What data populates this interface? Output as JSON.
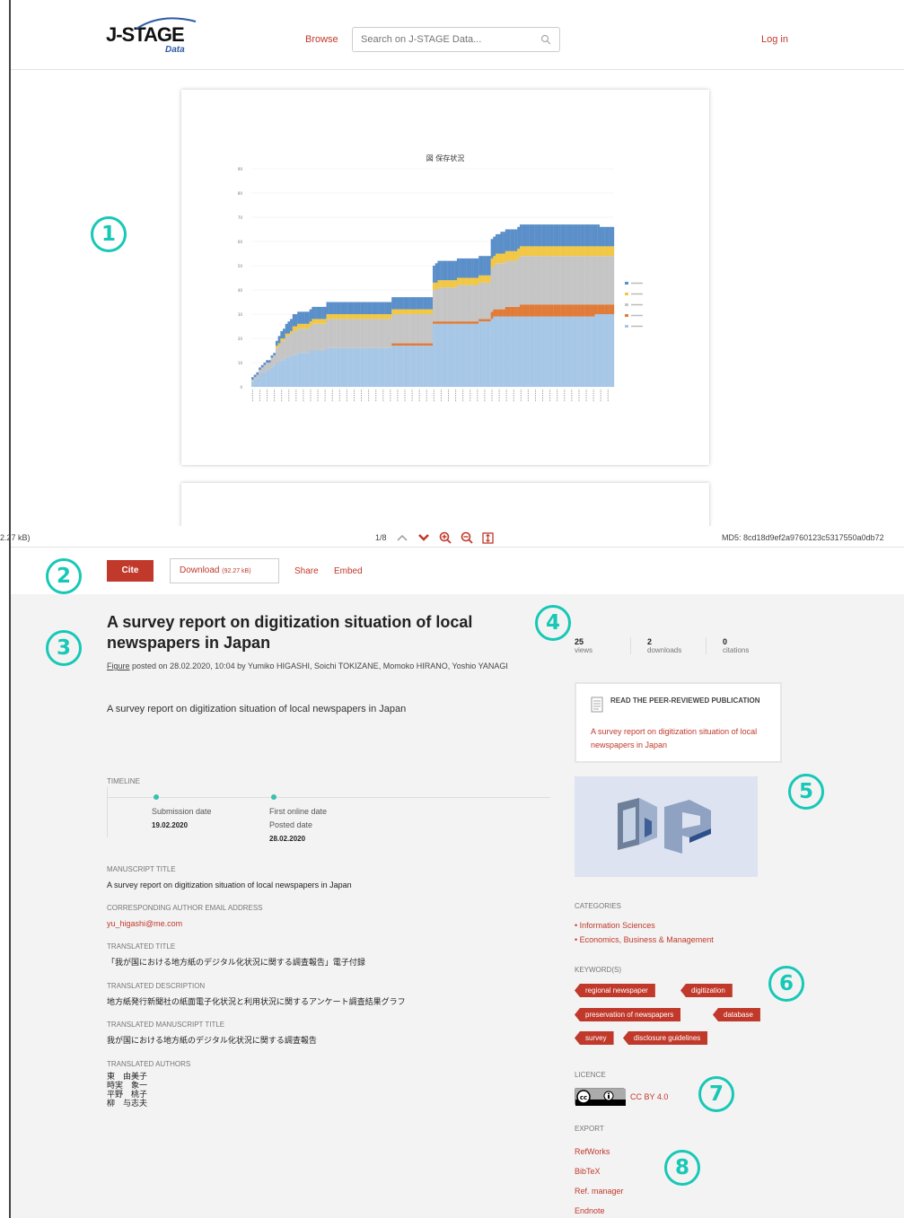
{
  "header": {
    "logo_text": "J-STAGE",
    "logo_sub": "Data",
    "browse_label": "Browse",
    "search_placeholder": "Search on J-STAGE Data...",
    "login_label": "Log in"
  },
  "viewer": {
    "chart_title": "図 保存状況",
    "file_size_left": "2.27 kB)",
    "page_indicator": "1/8",
    "md5": "MD5: 8cd18d9ef2a9760123c5317550a0db72"
  },
  "chart_data": {
    "type": "area",
    "title": "図 保存状況",
    "ylim": [
      0,
      90
    ],
    "yticks": [
      "0",
      "10",
      "20",
      "30",
      "40",
      "50",
      "60",
      "70",
      "80",
      "90"
    ],
    "x_count": 150,
    "stacked": true,
    "series": [
      {
        "color": "#a7c7e6",
        "values": [
          2,
          3,
          4,
          5,
          6,
          6,
          7,
          7,
          8,
          9,
          10,
          10,
          11,
          11,
          12,
          12,
          13,
          13,
          13,
          14,
          14,
          14,
          14,
          14,
          15,
          15,
          15,
          15,
          15,
          15,
          15,
          16,
          16,
          16,
          16,
          16,
          16,
          16,
          16,
          16,
          16,
          16,
          16,
          16,
          16,
          16,
          16,
          16,
          16,
          16,
          16,
          16,
          16,
          16,
          16,
          16,
          16,
          16,
          17,
          17,
          17,
          17,
          17,
          17,
          17,
          17,
          17,
          17,
          17,
          17,
          17,
          17,
          17,
          17,
          17,
          26,
          26,
          26,
          26,
          26,
          26,
          26,
          26,
          26,
          26,
          26,
          26,
          26,
          26,
          26,
          26,
          26,
          26,
          26,
          27,
          27,
          27,
          27,
          27,
          28,
          29,
          29,
          29,
          29,
          29,
          29,
          29,
          29,
          29,
          29,
          29,
          29,
          29,
          29,
          29,
          29,
          29,
          29,
          29,
          29,
          29,
          29,
          29,
          29,
          29,
          29,
          29,
          29,
          29,
          29,
          29,
          29,
          29,
          29,
          29,
          29,
          29,
          29,
          29,
          29,
          29,
          29,
          30,
          30,
          30,
          30,
          30,
          30,
          30,
          30
        ]
      },
      {
        "color": "#e07b39",
        "values": [
          0,
          0,
          0,
          0,
          0,
          0,
          0,
          0,
          0,
          0,
          0,
          0,
          0,
          0,
          0,
          0,
          0,
          0,
          0,
          0,
          0,
          0,
          0,
          0,
          0,
          0,
          0,
          0,
          0,
          0,
          0,
          0,
          0,
          0,
          0,
          0,
          0,
          0,
          0,
          0,
          0,
          0,
          0,
          0,
          0,
          0,
          0,
          0,
          0,
          0,
          0,
          0,
          0,
          0,
          0,
          0,
          0,
          0,
          1,
          1,
          1,
          1,
          1,
          1,
          1,
          1,
          1,
          1,
          1,
          1,
          1,
          1,
          1,
          1,
          1,
          1,
          1,
          1,
          1,
          1,
          1,
          1,
          1,
          1,
          1,
          1,
          1,
          1,
          1,
          1,
          1,
          1,
          1,
          1,
          1,
          1,
          1,
          1,
          1,
          3,
          3,
          3,
          3,
          3,
          3,
          4,
          4,
          4,
          4,
          4,
          4,
          5,
          5,
          5,
          5,
          5,
          5,
          5,
          5,
          5,
          5,
          5,
          5,
          5,
          5,
          5,
          5,
          5,
          5,
          5,
          5,
          5,
          5,
          5,
          5,
          5,
          5,
          5,
          5,
          5,
          5,
          5,
          4,
          4,
          4,
          4,
          4,
          4,
          4,
          4
        ]
      },
      {
        "color": "#c5c5c5",
        "values": [
          1,
          1,
          1,
          2,
          2,
          3,
          3,
          3,
          4,
          4,
          6,
          7,
          8,
          8,
          9,
          9,
          9,
          10,
          10,
          10,
          10,
          10,
          10,
          10,
          10,
          11,
          11,
          11,
          11,
          11,
          11,
          12,
          12,
          12,
          12,
          12,
          12,
          12,
          12,
          12,
          12,
          12,
          12,
          12,
          12,
          12,
          12,
          12,
          12,
          12,
          12,
          12,
          12,
          12,
          12,
          12,
          12,
          12,
          12,
          12,
          12,
          12,
          12,
          12,
          12,
          12,
          12,
          12,
          12,
          12,
          12,
          12,
          12,
          12,
          12,
          13,
          13,
          14,
          14,
          14,
          14,
          14,
          14,
          14,
          14,
          15,
          15,
          15,
          15,
          15,
          15,
          15,
          15,
          15,
          15,
          15,
          15,
          15,
          15,
          18,
          18,
          19,
          19,
          19,
          19,
          19,
          19,
          19,
          19,
          19,
          20,
          20,
          20,
          20,
          20,
          20,
          20,
          20,
          20,
          20,
          20,
          20,
          20,
          20,
          20,
          20,
          20,
          20,
          20,
          20,
          20,
          20,
          20,
          20,
          20,
          20,
          20,
          20,
          20,
          20,
          20,
          20,
          20,
          20,
          20,
          20,
          20,
          20,
          20,
          20
        ]
      },
      {
        "color": "#f2c744",
        "values": [
          0,
          0,
          0,
          0,
          0,
          0,
          0,
          0,
          0,
          0,
          1,
          1,
          1,
          1,
          1,
          1,
          1,
          2,
          2,
          2,
          2,
          2,
          2,
          2,
          2,
          2,
          2,
          2,
          2,
          2,
          2,
          2,
          2,
          2,
          2,
          2,
          2,
          2,
          2,
          2,
          2,
          2,
          2,
          2,
          2,
          2,
          2,
          2,
          2,
          2,
          2,
          2,
          2,
          2,
          2,
          2,
          2,
          2,
          2,
          2,
          2,
          2,
          2,
          2,
          2,
          2,
          2,
          2,
          2,
          2,
          2,
          2,
          2,
          2,
          2,
          3,
          3,
          3,
          3,
          3,
          3,
          3,
          3,
          3,
          3,
          3,
          3,
          3,
          3,
          3,
          3,
          3,
          3,
          3,
          3,
          3,
          3,
          3,
          3,
          4,
          4,
          4,
          4,
          4,
          4,
          4,
          4,
          4,
          4,
          4,
          4,
          4,
          4,
          4,
          4,
          4,
          4,
          4,
          4,
          4,
          4,
          4,
          4,
          4,
          4,
          4,
          4,
          4,
          4,
          4,
          4,
          4,
          4,
          4,
          4,
          4,
          4,
          4,
          4,
          4,
          4,
          4,
          4,
          4,
          4,
          4,
          4,
          4,
          4,
          4
        ]
      },
      {
        "color": "#5b8fc9",
        "values": [
          1,
          1,
          1,
          1,
          1,
          1,
          1,
          1,
          1,
          1,
          2,
          3,
          3,
          4,
          4,
          5,
          5,
          5,
          5,
          5,
          5,
          5,
          5,
          5,
          5,
          5,
          5,
          5,
          5,
          5,
          5,
          5,
          5,
          5,
          5,
          5,
          5,
          5,
          5,
          5,
          5,
          5,
          5,
          5,
          5,
          5,
          5,
          5,
          5,
          5,
          5,
          5,
          5,
          5,
          5,
          5,
          5,
          5,
          5,
          5,
          5,
          5,
          5,
          5,
          5,
          5,
          5,
          5,
          5,
          5,
          5,
          5,
          5,
          5,
          5,
          7,
          8,
          8,
          8,
          8,
          8,
          8,
          8,
          8,
          8,
          8,
          8,
          8,
          8,
          8,
          8,
          8,
          8,
          8,
          8,
          8,
          8,
          8,
          8,
          8,
          8,
          8,
          8,
          9,
          9,
          9,
          9,
          9,
          9,
          9,
          9,
          9,
          9,
          9,
          9,
          9,
          9,
          9,
          9,
          9,
          9,
          9,
          9,
          9,
          9,
          9,
          9,
          9,
          9,
          9,
          9,
          9,
          9,
          9,
          9,
          9,
          9,
          9,
          9,
          9,
          9,
          9,
          9,
          9,
          8,
          8,
          8,
          8,
          8,
          8
        ]
      }
    ],
    "legend_position": "right"
  },
  "actions": {
    "cite_label": "Cite",
    "download_label": "Download",
    "download_size": "(92.27 kB)",
    "share_label": "Share",
    "embed_label": "Embed"
  },
  "article": {
    "title": "A survey report on digitization situation of local newspapers in Japan",
    "type_label": "Figure",
    "byline": "posted on 28.02.2020, 10:04 by  Yumiko HIGASHI,  Soichi TOKIZANE,  Momoko HIRANO,  Yoshio YANAGI",
    "description": "A survey report on digitization situation of local newspapers in Japan"
  },
  "timeline": {
    "label": "TIMELINE",
    "submission_label": "Submission date",
    "submission_date": "19.02.2020",
    "first_online_label": "First online date",
    "posted_label": "Posted date",
    "posted_date": "28.02.2020"
  },
  "fields": {
    "manuscript_title_label": "MANUSCRIPT TITLE",
    "manuscript_title": "A survey report on digitization situation of local newspapers in Japan",
    "email_label": "CORRESPONDING AUTHOR EMAIL ADDRESS",
    "email": "yu_higashi@me.com",
    "translated_title_label": "TRANSLATED TITLE",
    "translated_title": "「我が国における地方紙のデジタル化状況に関する調査報告」電子付録",
    "translated_desc_label": "TRANSLATED DESCRIPTION",
    "translated_desc": "地方紙発行新聞社の紙面電子化状況と利用状況に関するアンケート調査結果グラフ",
    "translated_ms_title_label": "TRANSLATED MANUSCRIPT TITLE",
    "translated_ms_title": "我が国における地方紙のデジタル化状況に関する調査報告",
    "translated_authors_label": "TRANSLATED AUTHORS",
    "translated_authors": [
      "東　由美子",
      "時実　象一",
      "平野　桃子",
      "柳　与志夫"
    ]
  },
  "stats": {
    "views": "25",
    "views_label": "views",
    "downloads": "2",
    "downloads_label": "downloads",
    "citations": "0",
    "citations_label": "citations"
  },
  "peer": {
    "heading": "READ THE PEER-REVIEWED PUBLICATION",
    "link": "A survey report on digitization situation of local newspapers in Japan"
  },
  "sidebar": {
    "categories_label": "CATEGORIES",
    "categories": [
      "Information Sciences",
      "Economics, Business & Management"
    ],
    "keywords_label": "KEYWORD(S)",
    "keywords": [
      "regional newspaper",
      "digitization",
      "preservation of newspapers",
      "database",
      "survey",
      "disclosure guidelines"
    ],
    "licence_label": "LICENCE",
    "licence": "CC BY 4.0",
    "export_label": "EXPORT",
    "exports": [
      "RefWorks",
      "BibTeX",
      "Ref. manager",
      "Endnote"
    ]
  },
  "markers": [
    "1",
    "2",
    "3",
    "4",
    "5",
    "6",
    "7",
    "8"
  ],
  "colors": {
    "accent": "#c0392b",
    "marker": "#17c8b6",
    "timeline_dot": "#3bbfad"
  }
}
